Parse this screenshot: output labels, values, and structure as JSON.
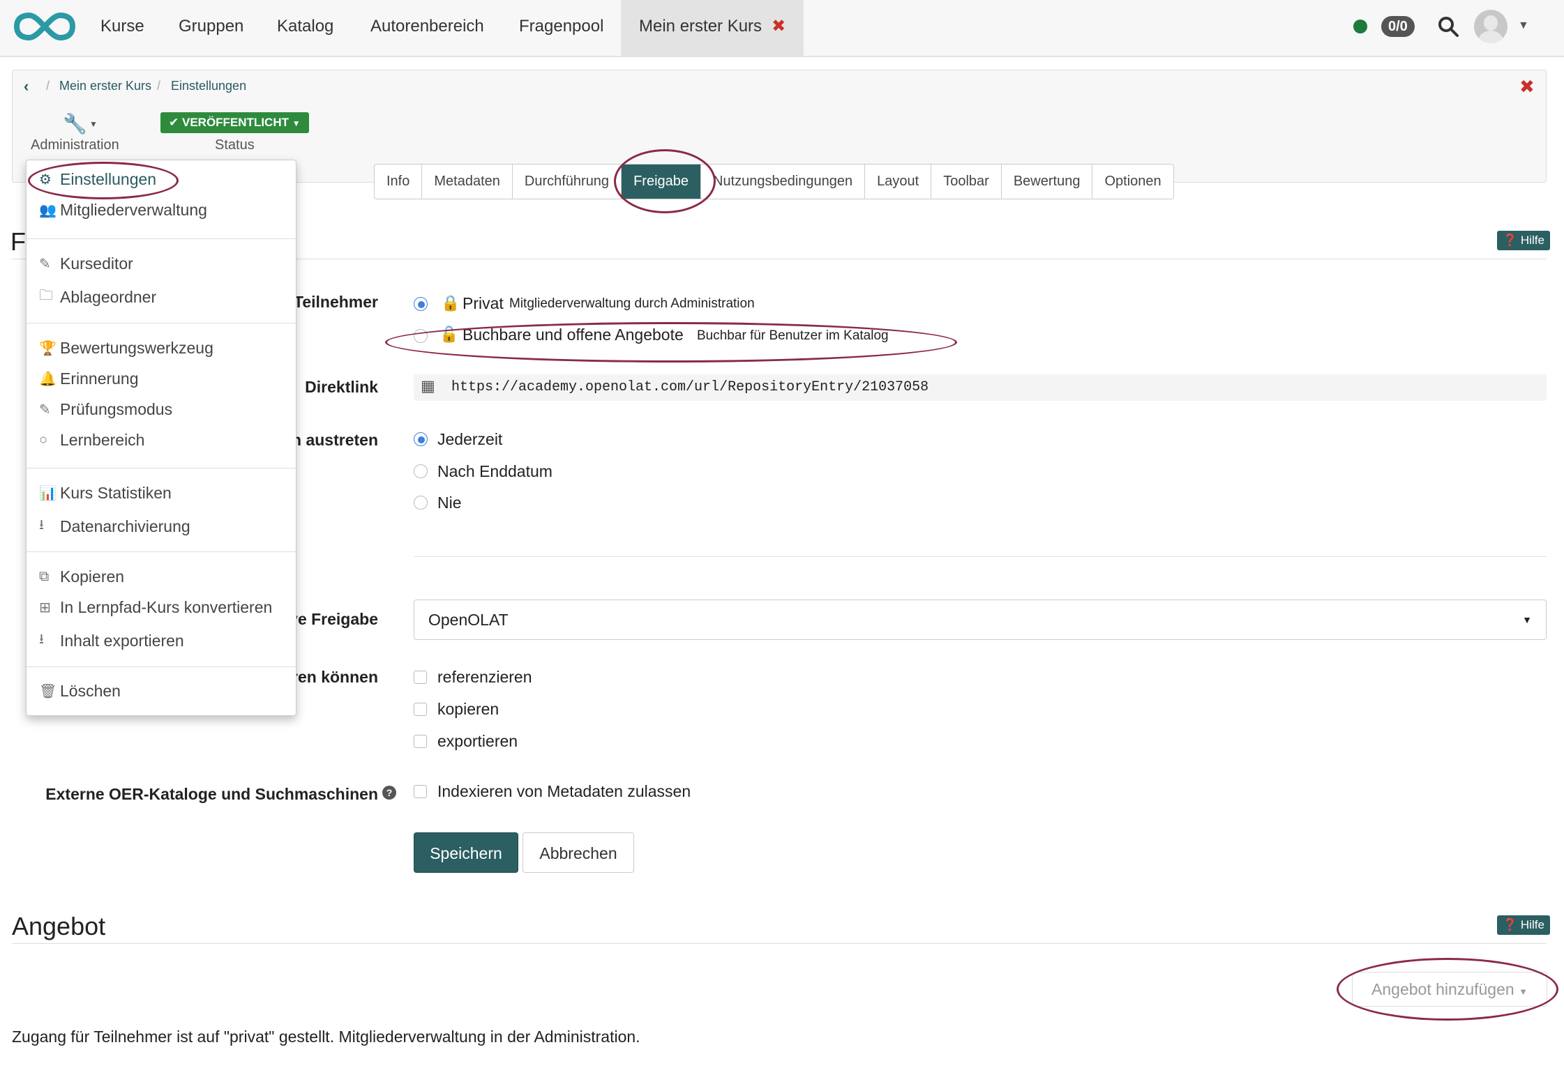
{
  "nav": {
    "items": [
      "Kurse",
      "Gruppen",
      "Katalog",
      "Autorenbereich",
      "Fragenpool"
    ],
    "active_tab": "Mein erster Kurs",
    "badge": "0/0"
  },
  "breadcrumb": {
    "items": [
      "Mein erster Kurs",
      "Einstellungen"
    ]
  },
  "toolbar": {
    "administration_label": "Administration",
    "status_button": "VERÖFFENTLICHT",
    "status_label": "Status"
  },
  "tabs": [
    "Info",
    "Metadaten",
    "Durchführung",
    "Freigabe",
    "Nutzungsbedingungen",
    "Layout",
    "Toolbar",
    "Bewertung",
    "Optionen"
  ],
  "active_tab": "Freigabe",
  "hilfe_label": "Hilfe",
  "section_initial": "F",
  "menu": {
    "groups": [
      [
        "Einstellungen",
        "Mitgliederverwaltung"
      ],
      [
        "Kurseditor",
        "Ablageordner"
      ],
      [
        "Bewertungswerkzeug",
        "Erinnerung",
        "Prüfungsmodus",
        "Lernbereich"
      ],
      [
        "Kurs Statistiken",
        "Datenarchivierung"
      ],
      [
        "Kopieren",
        "In Lernpfad-Kurs konvertieren",
        "Inhalt exportieren"
      ],
      [
        "Löschen"
      ]
    ]
  },
  "form": {
    "teilnehmer_label": "Teilnehmer",
    "access_options": [
      {
        "label": "Privat",
        "hint": "Mitgliederverwaltung durch Administration",
        "selected": true
      },
      {
        "label": "Buchbare und offene Angebote",
        "hint": "Buchbar für Benutzer im Katalog",
        "selected": false
      }
    ],
    "direktlink_label": "Direktlink",
    "direktlink_value": "https://academy.openolat.com/url/RepositoryEntry/21037058",
    "austreten_label": "n austreten",
    "leave_options": [
      {
        "label": "Jederzeit",
        "selected": true
      },
      {
        "label": "Nach Enddatum",
        "selected": false
      },
      {
        "label": "Nie",
        "selected": false
      }
    ],
    "freigabe_label": "ve Freigabe",
    "freigabe_value": "OpenOLAT",
    "koennen_label": "ren können",
    "permissions": [
      "referenzieren",
      "kopieren",
      "exportieren"
    ],
    "oer_label": "Externe OER-Kataloge und Suchmaschinen",
    "oer_option": "Indexieren von Metadaten zulassen",
    "save": "Speichern",
    "cancel": "Abbrechen"
  },
  "angebot": {
    "title": "Angebot",
    "add_button": "Angebot hinzufügen",
    "info": "Zugang für Teilnehmer ist auf \"privat\" gestellt. Mitgliederverwaltung in der Administration."
  },
  "colors": {
    "primary": "#2b5f62",
    "published": "#2e8b3e",
    "close": "#c9302c",
    "highlight": "#8a2a4a"
  }
}
